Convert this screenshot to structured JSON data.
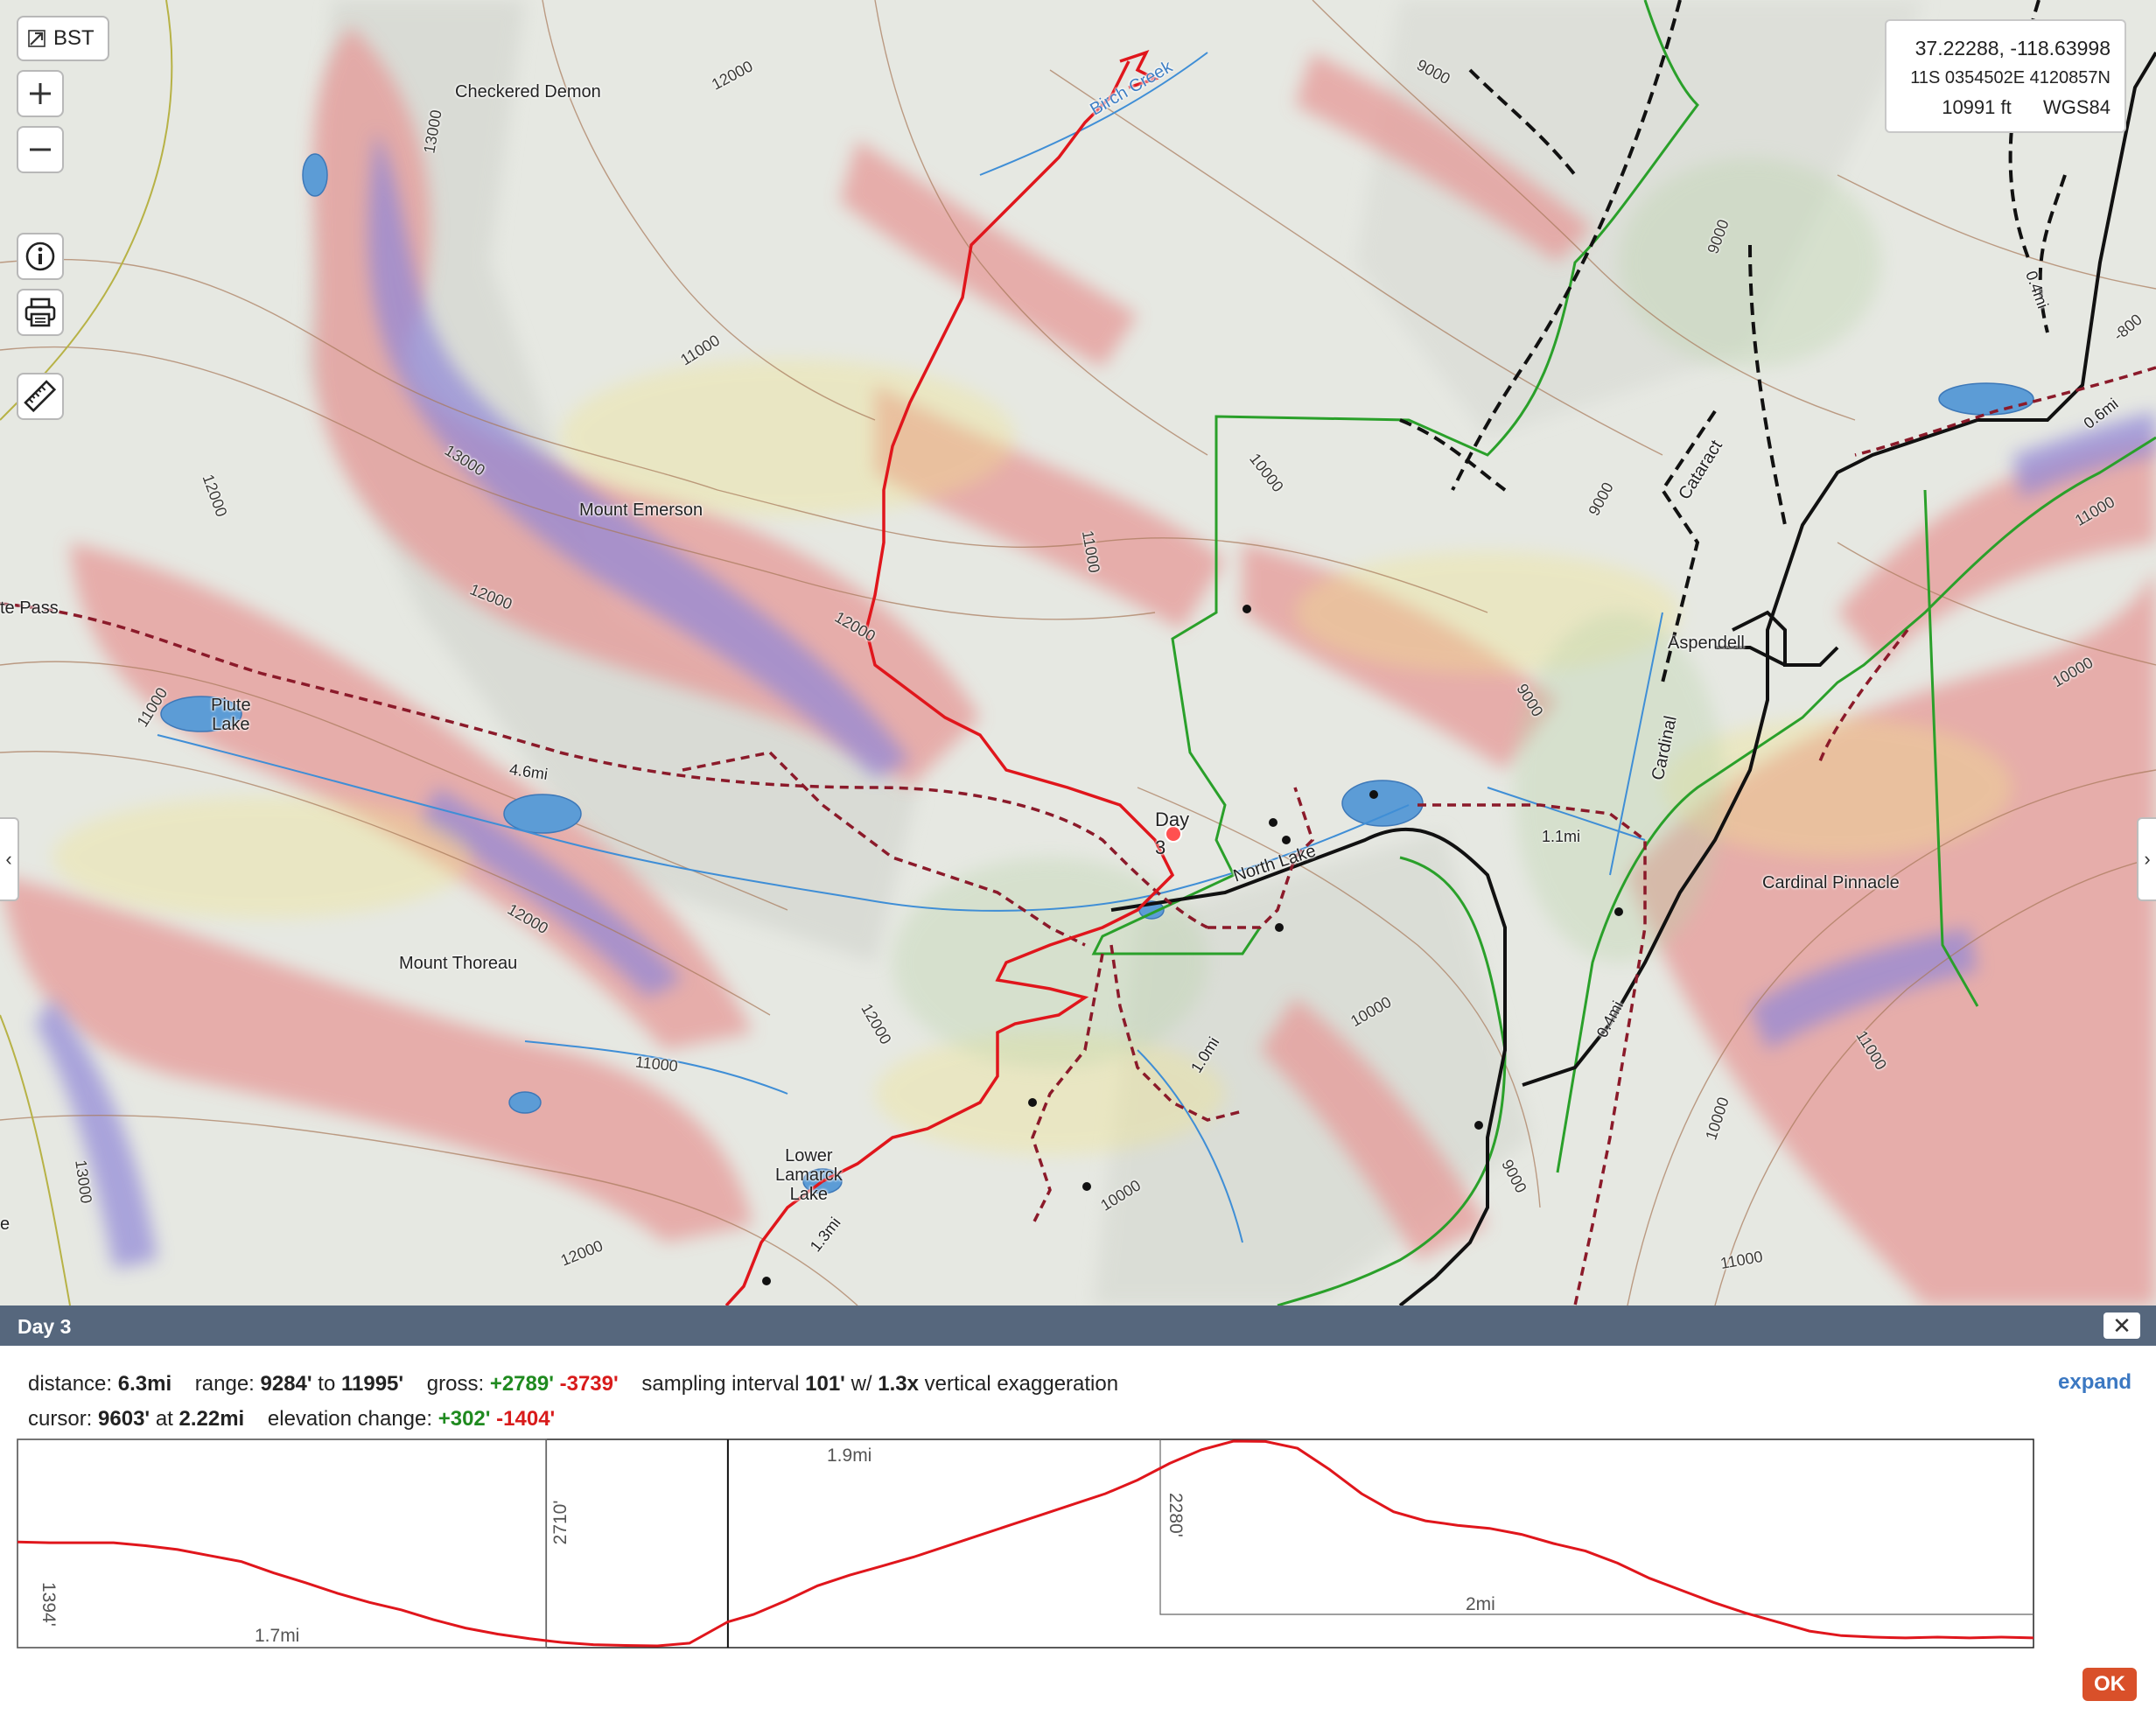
{
  "map": {
    "labels": {
      "checkered_demon": "Checkered Demon",
      "mount_emerson": "Mount Emerson",
      "mount_thoreau": "Mount Thoreau",
      "piute_lake": "Piute\nLake",
      "piute_pass": "te Pass",
      "lower_lamarck_lake": "Lower\nLamarck\nLake",
      "north_lake": "North Lake",
      "aspendell": "Aspendell",
      "cataract": "Cataract",
      "cardinal": "Cardinal",
      "cardinal_pinnacle": "Cardinal Pinnacle",
      "birch_creek": "Birch Creek",
      "day_marker_line1": "Day",
      "day_marker_line2": "3",
      "edge_e": "e"
    },
    "distance_labels": [
      "4.6mi",
      "1.1mi",
      "1.0mi",
      "1.3mi",
      "0.4mi",
      "0.6mi",
      "0.4mi"
    ],
    "contour_labels": [
      "12000",
      "11000",
      "13000",
      "12000",
      "11000",
      "13000",
      "12000",
      "9000",
      "9000",
      "10000",
      "11000",
      "12000",
      "9000",
      "9000",
      "9000",
      "10000",
      "11000",
      "12000",
      "12000",
      "11000",
      "10000",
      "10000",
      "10000",
      "11000",
      "9000",
      "11000",
      "12000",
      "13000",
      "-800"
    ]
  },
  "controls": {
    "bst_label": "BST",
    "zoom_in": "+",
    "zoom_out": "−"
  },
  "coords": {
    "latlon": "37.22288, -118.63998",
    "utm": "11S 0354502E 4120857N",
    "elevation": "10991 ft",
    "datum": "WGS84"
  },
  "side_tabs": {
    "left": "‹",
    "right": "›"
  },
  "panel": {
    "title": "Day 3",
    "close": "✕",
    "expand": "expand",
    "ok": "OK",
    "stats": {
      "distance_label": "distance:",
      "distance": "6.3mi",
      "range_label": "range:",
      "range_min": "9284'",
      "range_to": "to",
      "range_max": "11995'",
      "gross_label": "gross:",
      "gross_gain": "+2789'",
      "gross_loss": "-3739'",
      "sampling_label": "sampling interval",
      "sampling": "101'",
      "with": "w/",
      "exaggeration": "1.3x",
      "exaggeration_label": "vertical exaggeration",
      "cursor_label": "cursor:",
      "cursor_elev": "9603'",
      "cursor_at": "at",
      "cursor_dist": "2.22mi",
      "elev_change_label": "elevation change:",
      "elev_gain": "+302'",
      "elev_loss": "-1404'"
    }
  },
  "profile_labels": {
    "left_height": "1394'",
    "left_dist": "1.7mi",
    "mid_height": "2710'",
    "mid_dist": "1.9mi",
    "right_height": "2280'",
    "right_dist": "2mi"
  },
  "chart_data": {
    "type": "line",
    "xlabel": "",
    "ylabel": "",
    "x": [
      0,
      0.1,
      0.2,
      0.3,
      0.4,
      0.5,
      0.6,
      0.7,
      0.8,
      0.9,
      1.0,
      1.1,
      1.2,
      1.3,
      1.4,
      1.5,
      1.6,
      1.7,
      1.8,
      1.9,
      2.0,
      2.1,
      2.22,
      2.3,
      2.4,
      2.5,
      2.6,
      2.7,
      2.8,
      2.9,
      3.0,
      3.1,
      3.2,
      3.3,
      3.4,
      3.5,
      3.6,
      3.7,
      3.8,
      3.9,
      4.0,
      4.1,
      4.2,
      4.3,
      4.4,
      4.5,
      4.6,
      4.7,
      4.8,
      4.9,
      5.0,
      5.1,
      5.2,
      5.3,
      5.4,
      5.5,
      5.6,
      5.7,
      5.8,
      5.9,
      6.0,
      6.1,
      6.2,
      6.3
    ],
    "series": [
      {
        "values": [
          10660,
          10650,
          10650,
          10650,
          10610,
          10560,
          10480,
          10400,
          10250,
          10120,
          9980,
          9860,
          9760,
          9630,
          9520,
          9440,
          9380,
          9330,
          9300,
          9290,
          9284,
          9320,
          9603,
          9700,
          9880,
          10080,
          10220,
          10340,
          10460,
          10600,
          10740,
          10880,
          11020,
          11160,
          11300,
          11480,
          11700,
          11880,
          11995,
          11990,
          11900,
          11620,
          11300,
          11060,
          10940,
          10880,
          10840,
          10760,
          10640,
          10540,
          10380,
          10180,
          10020,
          9860,
          9720,
          9600,
          9480,
          9420,
          9400,
          9390,
          9400,
          9390,
          9400,
          9390
        ]
      }
    ],
    "ylim": [
      9284,
      11995
    ],
    "cursor_x": 2.22
  }
}
